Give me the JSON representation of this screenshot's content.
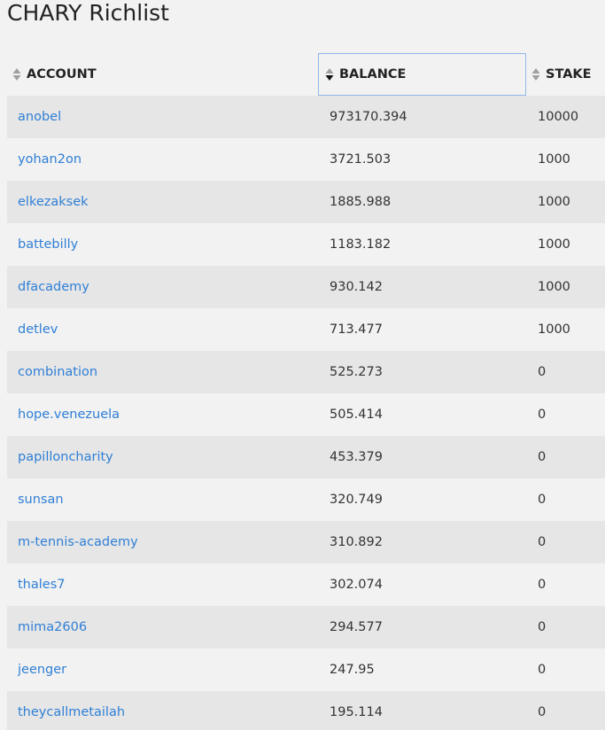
{
  "page": {
    "title": "CHARY Richlist"
  },
  "table": {
    "columns": [
      {
        "key": "account",
        "label": "ACCOUNT",
        "sort": "none"
      },
      {
        "key": "balance",
        "label": "BALANCE",
        "sort": "desc"
      },
      {
        "key": "stake",
        "label": "STAKE",
        "sort": "none"
      }
    ],
    "rows": [
      {
        "account": "anobel",
        "balance": "973170.394",
        "stake": "10000"
      },
      {
        "account": "yohan2on",
        "balance": "3721.503",
        "stake": "1000"
      },
      {
        "account": "elkezaksek",
        "balance": "1885.988",
        "stake": "1000"
      },
      {
        "account": "battebilly",
        "balance": "1183.182",
        "stake": "1000"
      },
      {
        "account": "dfacademy",
        "balance": "930.142",
        "stake": "1000"
      },
      {
        "account": "detlev",
        "balance": "713.477",
        "stake": "1000"
      },
      {
        "account": "combination",
        "balance": "525.273",
        "stake": "0"
      },
      {
        "account": "hope.venezuela",
        "balance": "505.414",
        "stake": "0"
      },
      {
        "account": "papilloncharity",
        "balance": "453.379",
        "stake": "0"
      },
      {
        "account": "sunsan",
        "balance": "320.749",
        "stake": "0"
      },
      {
        "account": "m-tennis-academy",
        "balance": "310.892",
        "stake": "0"
      },
      {
        "account": "thales7",
        "balance": "302.074",
        "stake": "0"
      },
      {
        "account": "mima2606",
        "balance": "294.577",
        "stake": "0"
      },
      {
        "account": "jeenger",
        "balance": "247.95",
        "stake": "0"
      },
      {
        "account": "theycallmetailah",
        "balance": "195.114",
        "stake": "0"
      }
    ]
  },
  "colors": {
    "link": "#2f7fd6",
    "row_odd": "#e6e6e6",
    "row_even": "#f2f2f2",
    "active_header_border": "#8fb8e8",
    "sort_inactive": "#a0a0a0",
    "sort_active": "#111111"
  },
  "icons": {
    "sort_none": "sort-both-icon",
    "sort_desc": "sort-descending-icon"
  }
}
